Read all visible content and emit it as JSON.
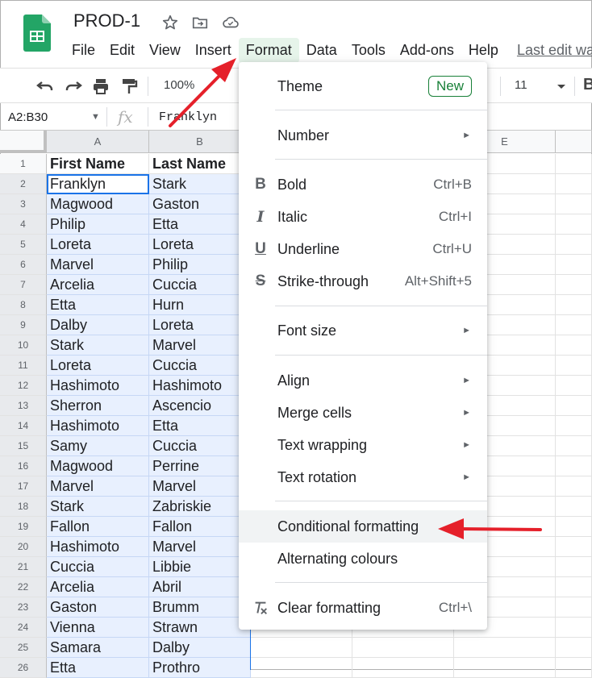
{
  "document": {
    "title": "PROD-1",
    "last_edit": "Last edit wa"
  },
  "menubar": [
    "File",
    "Edit",
    "View",
    "Insert",
    "Format",
    "Data",
    "Tools",
    "Add-ons",
    "Help"
  ],
  "toolbar": {
    "zoom": "100%",
    "font_size": "11"
  },
  "formula_bar": {
    "name_box": "A2:B30",
    "fx_symbol": "fx",
    "value": "Franklyn"
  },
  "columns": [
    "A",
    "B",
    "E"
  ],
  "rows": [
    {
      "n": "1",
      "a": "First Name",
      "b": "Last Name"
    },
    {
      "n": "2",
      "a": "Franklyn",
      "b": "Stark"
    },
    {
      "n": "3",
      "a": "Magwood",
      "b": "Gaston"
    },
    {
      "n": "4",
      "a": "Philip",
      "b": "Etta"
    },
    {
      "n": "5",
      "a": "Loreta",
      "b": "Loreta"
    },
    {
      "n": "6",
      "a": "Marvel",
      "b": "Philip"
    },
    {
      "n": "7",
      "a": "Arcelia",
      "b": "Cuccia"
    },
    {
      "n": "8",
      "a": "Etta",
      "b": "Hurn"
    },
    {
      "n": "9",
      "a": "Dalby",
      "b": "Loreta"
    },
    {
      "n": "10",
      "a": "Stark",
      "b": "Marvel"
    },
    {
      "n": "11",
      "a": "Loreta",
      "b": "Cuccia"
    },
    {
      "n": "12",
      "a": "Hashimoto",
      "b": "Hashimoto"
    },
    {
      "n": "13",
      "a": "Sherron",
      "b": "Ascencio"
    },
    {
      "n": "14",
      "a": "Hashimoto",
      "b": "Etta"
    },
    {
      "n": "15",
      "a": "Samy",
      "b": "Cuccia"
    },
    {
      "n": "16",
      "a": "Magwood",
      "b": "Perrine"
    },
    {
      "n": "17",
      "a": "Marvel",
      "b": "Marvel"
    },
    {
      "n": "18",
      "a": "Stark",
      "b": "Zabriskie"
    },
    {
      "n": "19",
      "a": "Fallon",
      "b": "Fallon"
    },
    {
      "n": "20",
      "a": "Hashimoto",
      "b": "Marvel"
    },
    {
      "n": "21",
      "a": "Cuccia",
      "b": "Libbie"
    },
    {
      "n": "22",
      "a": "Arcelia",
      "b": "Abril"
    },
    {
      "n": "23",
      "a": "Gaston",
      "b": "Brumm"
    },
    {
      "n": "24",
      "a": "Vienna",
      "b": "Strawn"
    },
    {
      "n": "25",
      "a": "Samara",
      "b": "Dalby"
    },
    {
      "n": "26",
      "a": "Etta",
      "b": "Prothro"
    }
  ],
  "format_menu": {
    "theme": {
      "label": "Theme",
      "badge": "New"
    },
    "number": {
      "label": "Number"
    },
    "bold": {
      "label": "Bold",
      "shortcut": "Ctrl+B",
      "icon": "B"
    },
    "italic": {
      "label": "Italic",
      "shortcut": "Ctrl+I",
      "icon": "I"
    },
    "underline": {
      "label": "Underline",
      "shortcut": "Ctrl+U",
      "icon": "U"
    },
    "strike": {
      "label": "Strike-through",
      "shortcut": "Alt+Shift+5",
      "icon": "S"
    },
    "font_size": {
      "label": "Font size"
    },
    "align": {
      "label": "Align"
    },
    "merge": {
      "label": "Merge cells"
    },
    "wrap": {
      "label": "Text wrapping"
    },
    "rotation": {
      "label": "Text rotation"
    },
    "conditional": {
      "label": "Conditional formatting"
    },
    "alternating": {
      "label": "Alternating colours"
    },
    "clear": {
      "label": "Clear formatting",
      "shortcut": "Ctrl+\\"
    }
  },
  "colors": {
    "accent": "#1a73e8",
    "selection": "#e8f0fe",
    "annotation_arrow": "#e5202a",
    "brand_green": "#188038"
  }
}
